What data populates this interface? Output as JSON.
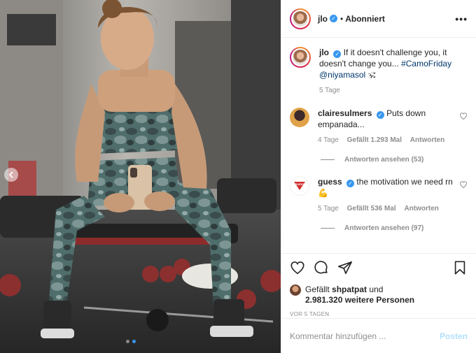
{
  "post": {
    "image_alt": "Mirror selfie in a gym",
    "carousel": {
      "prev_icon": "chevron-left-icon",
      "dot_count": 2,
      "active_index": 1
    }
  },
  "header": {
    "username": "jlo",
    "verified_icon": "verified-badge-icon",
    "separator": "•",
    "follow_state": "Abonniert",
    "more_icon": "more-horizontal-icon"
  },
  "caption": {
    "username": "jlo",
    "text": "If it doesn't challenge you, it doesn't change you...",
    "hashtag": "#CamoFriday",
    "mention": "@niyamasol",
    "emoji": "🕉",
    "time": "5 Tage"
  },
  "comments": [
    {
      "username": "clairesulmers",
      "text": "Puts down empanada...",
      "time": "4 Tage",
      "likes": "Gefällt 1.293 Mal",
      "reply": "Antworten",
      "view_replies": "Antworten ansehen (53)"
    },
    {
      "username": "guess",
      "text": "the motivation we need rn",
      "emoji": "💪",
      "time": "5 Tage",
      "likes": "Gefällt 536 Mal",
      "reply": "Antworten",
      "view_replies": "Antworten ansehen (97)"
    }
  ],
  "actions": {
    "like_icon": "heart-icon",
    "comment_icon": "comment-icon",
    "share_icon": "paper-plane-icon",
    "save_icon": "bookmark-icon"
  },
  "likes": {
    "prefix": "Gefällt",
    "user": "shpatpat",
    "conj": "und",
    "count": "2.981.320 weitere Personen"
  },
  "timestamp": "VOR 5 TAGEN",
  "comment_box": {
    "placeholder": "Kommentar hinzufügen ...",
    "post_label": "Posten"
  },
  "colors": {
    "accent": "#3897f0",
    "post_disabled": "#b2dffc",
    "meta": "#8e8e8e"
  }
}
